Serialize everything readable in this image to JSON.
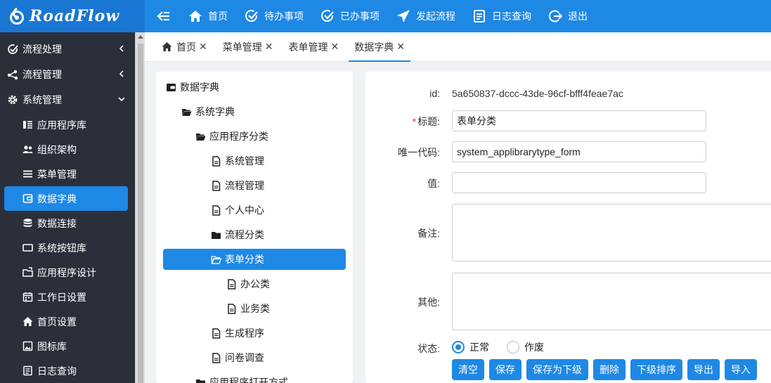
{
  "app": {
    "logo_text": "RoadFlow"
  },
  "topnav": [
    {
      "label": "首页",
      "icon": "home-icon"
    },
    {
      "label": "待办事项",
      "icon": "check-circle-icon"
    },
    {
      "label": "已办事项",
      "icon": "check-circle-icon"
    },
    {
      "label": "发起流程",
      "icon": "send-icon"
    },
    {
      "label": "日志查询",
      "icon": "document-icon"
    },
    {
      "label": "退出",
      "icon": "logout-icon"
    }
  ],
  "sidebar": {
    "groups": [
      {
        "label": "流程处理",
        "icon": "edit-check-icon",
        "expanded": false
      },
      {
        "label": "流程管理",
        "icon": "share-icon",
        "expanded": false
      },
      {
        "label": "系统管理",
        "icon": "gear-icon",
        "expanded": true
      }
    ],
    "items": [
      {
        "label": "应用程序库",
        "icon": "list-icon"
      },
      {
        "label": "组织架构",
        "icon": "users-icon"
      },
      {
        "label": "菜单管理",
        "icon": "menu-icon"
      },
      {
        "label": "数据字典",
        "icon": "wallet-icon",
        "active": true
      },
      {
        "label": "数据连接",
        "icon": "database-icon"
      },
      {
        "label": "系统按钮库",
        "icon": "window-icon"
      },
      {
        "label": "应用程序设计",
        "icon": "folder-edit-icon"
      },
      {
        "label": "工作日设置",
        "icon": "calendar-icon"
      },
      {
        "label": "首页设置",
        "icon": "home-icon"
      },
      {
        "label": "图标库",
        "icon": "image-icon"
      },
      {
        "label": "日志查询",
        "icon": "document-icon"
      }
    ]
  },
  "tabs": [
    {
      "label": "首页",
      "close": "✕"
    },
    {
      "label": "菜单管理",
      "close": "✕"
    },
    {
      "label": "表单管理",
      "close": "✕"
    },
    {
      "label": "数据字典",
      "close": "✕",
      "active": true
    }
  ],
  "tree": [
    {
      "label": "数据字典",
      "icon": "wallet-icon",
      "level": 0
    },
    {
      "label": "系统字典",
      "icon": "folder-open-icon",
      "level": 1
    },
    {
      "label": "应用程序分类",
      "icon": "folder-open-icon",
      "level": 2
    },
    {
      "label": "系统管理",
      "icon": "file-icon",
      "level": 3
    },
    {
      "label": "流程管理",
      "icon": "file-icon",
      "level": 3
    },
    {
      "label": "个人中心",
      "icon": "file-icon",
      "level": 3
    },
    {
      "label": "流程分类",
      "icon": "folder-icon",
      "level": 3
    },
    {
      "label": "表单分类",
      "icon": "folder-open-icon",
      "level": 3,
      "selected": true
    },
    {
      "label": "办公类",
      "icon": "file-icon",
      "level": 4
    },
    {
      "label": "业务类",
      "icon": "file-icon",
      "level": 4
    },
    {
      "label": "生成程序",
      "icon": "file-icon",
      "level": 3
    },
    {
      "label": "问卷调查",
      "icon": "file-icon",
      "level": 3
    },
    {
      "label": "应用程序打开方式",
      "icon": "folder-icon",
      "level": 2
    }
  ],
  "form": {
    "id_label": "id:",
    "id_value": "5a650837-dccc-43de-96cf-bfff4feae7ac",
    "title_required": "*",
    "title_label": "标题:",
    "title_value": "表单分类",
    "code_label": "唯一代码:",
    "code_value": "system_applibrarytype_form",
    "value_label": "值:",
    "value_value": "",
    "note_label": "备注:",
    "other_label": "其他:",
    "status_label": "状态:",
    "status_options": [
      "正常",
      "作废"
    ],
    "status_selected": "正常",
    "buttons": [
      "清空",
      "保存",
      "保存为下级",
      "删除",
      "下级排序",
      "导出",
      "导入"
    ]
  },
  "colors": {
    "primary": "#1e88e5",
    "sidebar_bg": "#2b2f3a",
    "logo_bg": "#1976d2"
  }
}
